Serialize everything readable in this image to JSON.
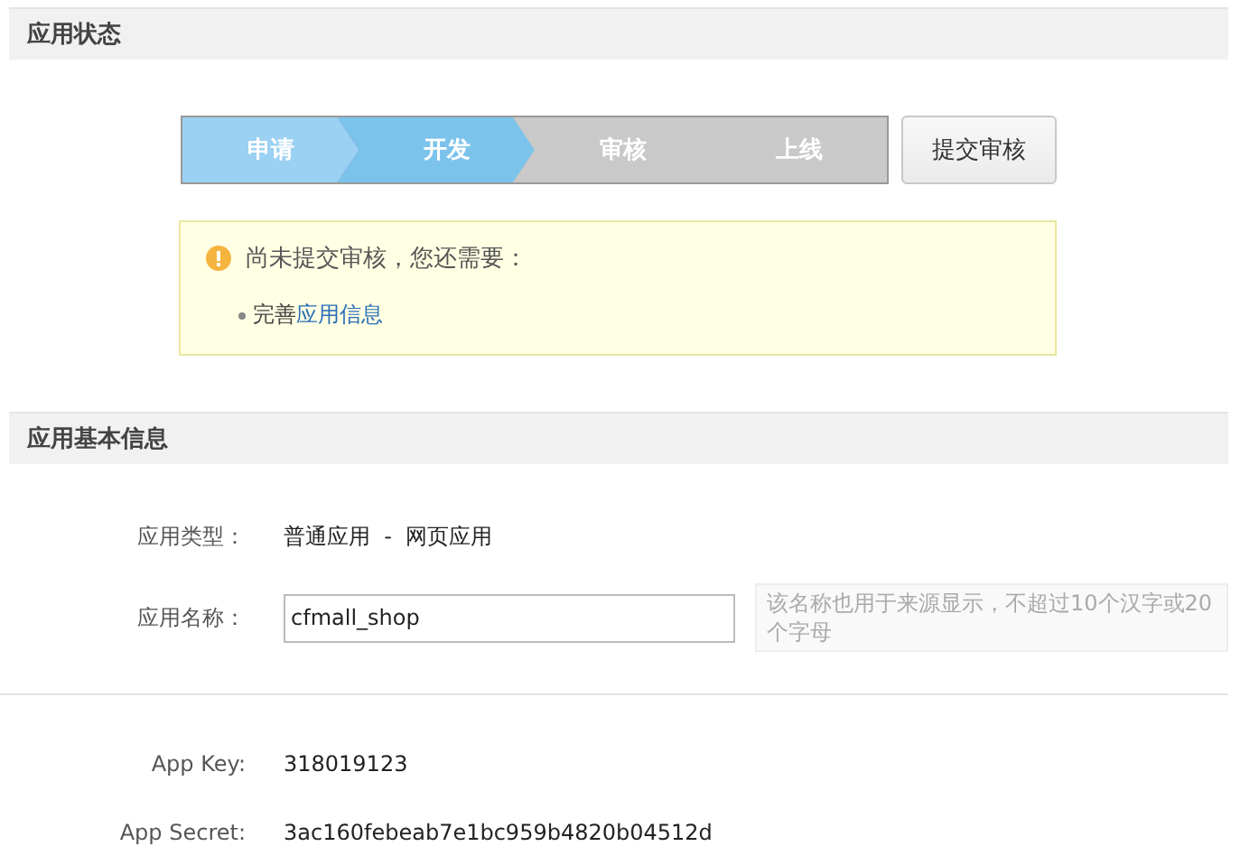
{
  "status_section": {
    "title": "应用状态",
    "steps": [
      {
        "label": "申请",
        "done": true
      },
      {
        "label": "开发",
        "done": true
      },
      {
        "label": "审核",
        "done": false
      },
      {
        "label": "上线",
        "done": false
      }
    ],
    "submit_button": "提交审核",
    "notice": {
      "message": "尚未提交审核，您还需要：",
      "items": [
        {
          "prefix": "完善",
          "link": "应用信息"
        }
      ]
    }
  },
  "info_section": {
    "title": "应用基本信息",
    "app_type": {
      "label": "应用类型：",
      "value": "普通应用  -  网页应用"
    },
    "app_name": {
      "label": "应用名称：",
      "value": "cfmall_shop",
      "hint": "该名称也用于来源显示，不超过10个汉字或20个字母"
    },
    "app_key": {
      "label": "App Key:",
      "value": "318019123"
    },
    "app_secret": {
      "label": "App Secret:",
      "value": "3ac160febeab7e1bc959b4820b04512d"
    }
  }
}
